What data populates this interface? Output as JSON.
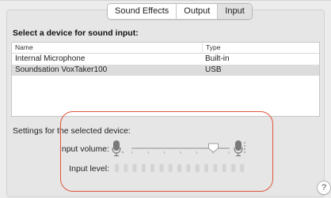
{
  "tabs": [
    {
      "label": "Sound Effects",
      "active": false
    },
    {
      "label": "Output",
      "active": false
    },
    {
      "label": "Input",
      "active": true
    }
  ],
  "heading": "Select a device for sound input:",
  "table": {
    "columns": [
      "Name",
      "Type"
    ],
    "rows": [
      {
        "name": "Internal Microphone",
        "type": "Built-in",
        "selected": false
      },
      {
        "name": "Soundsation VoxTaker100",
        "type": "USB",
        "selected": true
      }
    ]
  },
  "settings_label": "Settings for the selected device:",
  "input_volume": {
    "label": "Input volume:",
    "value_fraction": 0.84
  },
  "input_level": {
    "label": "Input level:",
    "segments": 15,
    "lit": 0
  },
  "help_label": "?",
  "colors": {
    "annotation": "#e0553a",
    "selected_row": "#dcdcdc"
  },
  "icons": [
    "microphone-low-icon",
    "microphone-high-icon",
    "help-icon"
  ]
}
